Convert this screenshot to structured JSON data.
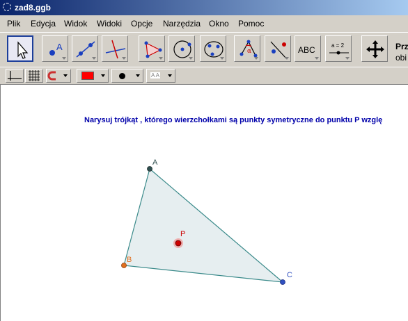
{
  "window": {
    "title": "zad8.ggb"
  },
  "menu": [
    "Plik",
    "Edycja",
    "Widok",
    "Widoki",
    "Opcje",
    "Narzędzia",
    "Okno",
    "Pomoc"
  ],
  "toolbar": {
    "tools": [
      {
        "name": "move-tool-icon",
        "selected": true
      },
      {
        "name": "point-tool-icon",
        "label": "A"
      },
      {
        "name": "line-tool-icon"
      },
      {
        "name": "perpendicular-line-tool-icon"
      },
      {
        "name": "polygon-tool-icon"
      },
      {
        "name": "circle-tool-icon"
      },
      {
        "name": "conic-tool-icon"
      },
      {
        "name": "angle-tool-icon",
        "label": "α"
      },
      {
        "name": "reflect-tool-icon"
      },
      {
        "name": "text-tool-icon",
        "label": "ABC"
      },
      {
        "name": "slider-tool-icon",
        "label": "a = 2"
      },
      {
        "name": "move-graphics-view-icon"
      }
    ],
    "help_title": "Prze",
    "help_subtitle": "obi"
  },
  "stylebar": {
    "colors": {
      "object_color": "#ff0000"
    },
    "text_style_label": "A A"
  },
  "canvas": {
    "instruction": "Narysuj trójkąt , którego wierzchołkami są punkty symetryczne do punktu P wzglę",
    "points": {
      "A": {
        "label": "A",
        "color": "#2f4f4f"
      },
      "B": {
        "label": "B",
        "color": "#e07020"
      },
      "C": {
        "label": "C",
        "color": "#3050c0"
      },
      "P": {
        "label": "P",
        "color": "#cc0000"
      }
    },
    "triangle_fill": "#e6eef0",
    "triangle_stroke": "#3a8a8a"
  }
}
